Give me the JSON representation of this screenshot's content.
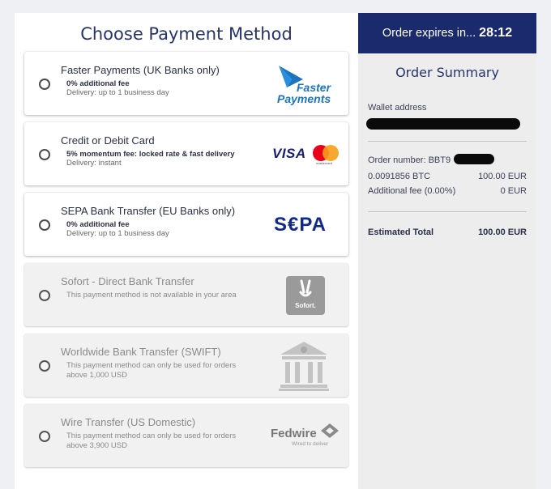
{
  "page_title": "Choose Payment Method",
  "methods": [
    {
      "title": "Faster Payments (UK Banks only)",
      "fee": "0% additional fee",
      "delivery": "Delivery: up to 1 business day",
      "logo_text_1": "Faster",
      "logo_text_2": "Payments",
      "icon": "faster-payments-logo"
    },
    {
      "title": "Credit or Debit Card",
      "fee": "5% momentum fee: locked rate & fast delivery",
      "delivery": "Delivery: instant",
      "logo_text_1": "VISA",
      "logo_text_2": "mastercard",
      "icon": "visa-mastercard-logo"
    },
    {
      "title": "SEPA Bank Transfer (EU Banks only)",
      "fee": "0% additional fee",
      "delivery": "Delivery: up to 1 business day",
      "logo_text_1": "S€PA",
      "icon": "sepa-logo"
    },
    {
      "title": "Sofort - Direct Bank Transfer",
      "note": "This payment method is not available in your area",
      "logo_text_1": "Sofort.",
      "icon": "sofort-logo"
    },
    {
      "title": "Worldwide Bank Transfer (SWIFT)",
      "note": "This payment method can only be used for orders above 1,000 USD",
      "icon": "bank-building-icon"
    },
    {
      "title": "Wire Transfer (US Domestic)",
      "note": "This payment method can only be used for orders above 3,900 USD",
      "logo_text_1": "Fedwire",
      "logo_text_2": "Wired to deliver",
      "icon": "fedwire-logo"
    }
  ],
  "order": {
    "expires_label": "Order expires in...",
    "expires_time": "28:12",
    "summary_title": "Order Summary",
    "wallet_label": "Wallet address",
    "order_number_label": "Order number: BBT9",
    "btc_amount": "0.0091856 BTC",
    "btc_value": "100.00 EUR",
    "fee_label": "Additional fee (0.00%)",
    "fee_value": "0 EUR",
    "total_label": "Estimated Total",
    "total_value": "100.00 EUR"
  },
  "colors": {
    "brand_navy": "#1a2a6c",
    "title_blue": "#26346b",
    "faster_blue": "#1e73be",
    "visa_blue": "#1a1f71",
    "mc_red": "#eb001b",
    "mc_orange": "#f79e1b",
    "sepa_blue": "#10298e",
    "sepa_yellow": "#ffcc00"
  }
}
